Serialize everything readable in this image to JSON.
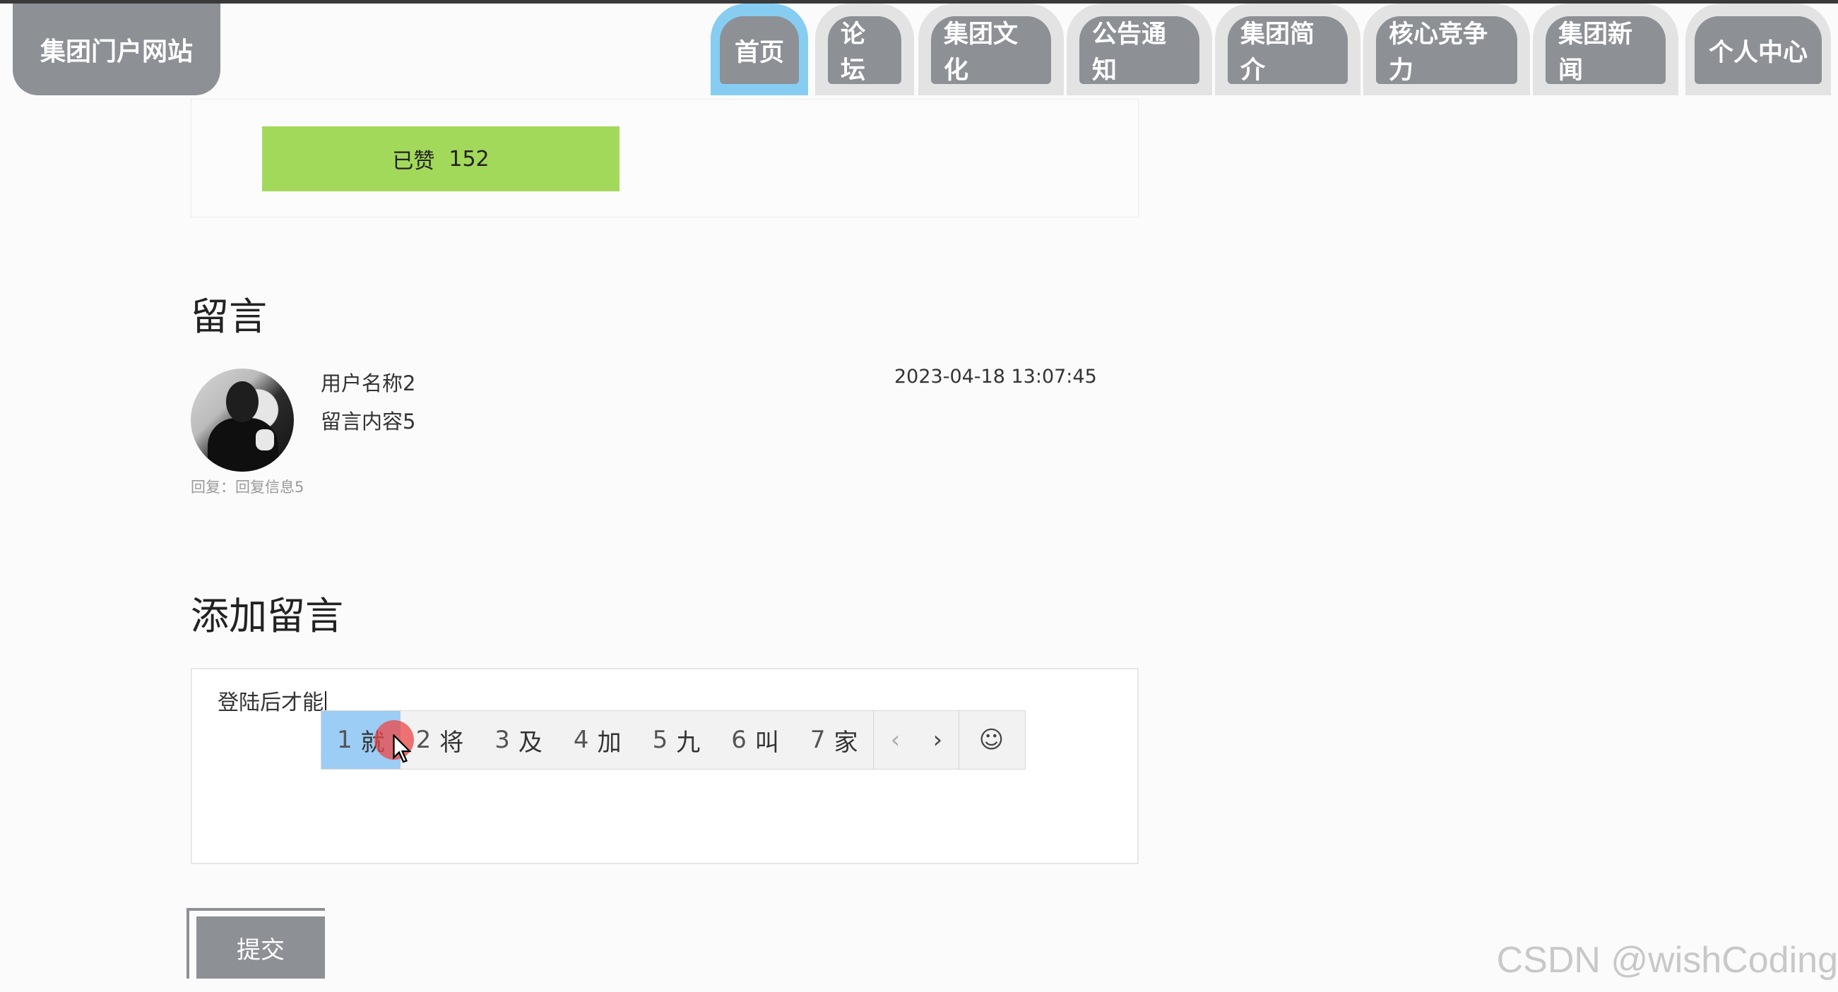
{
  "header": {
    "site_title": "集团门户网站",
    "nav": [
      {
        "label": "首页",
        "active": true
      },
      {
        "label": "论坛"
      },
      {
        "label": "集团文化"
      },
      {
        "label": "公告通知"
      },
      {
        "label": "集团简介"
      },
      {
        "label": "核心竞争力"
      },
      {
        "label": "集团新闻"
      },
      {
        "label": "个人中心"
      }
    ]
  },
  "like": {
    "label": "已赞",
    "count": "152",
    "color": "#a3d95a"
  },
  "comments_section": {
    "title": "留言",
    "items": [
      {
        "username": "用户名称2",
        "content": "留言内容5",
        "time": "2023-04-18 13:07:45",
        "reply": "回复：回复信息5"
      }
    ]
  },
  "add_comment": {
    "title": "添加留言",
    "textarea_value": "登陆后才能",
    "ime_candidates": [
      {
        "num": "1",
        "text": "就",
        "selected": true
      },
      {
        "num": "2",
        "text": "将"
      },
      {
        "num": "3",
        "text": "及"
      },
      {
        "num": "4",
        "text": "加"
      },
      {
        "num": "5",
        "text": "九"
      },
      {
        "num": "6",
        "text": "叫"
      },
      {
        "num": "7",
        "text": "家"
      }
    ],
    "ime_prev": "‹",
    "ime_next": "›",
    "ime_emoji": "☺",
    "submit_label": "提交"
  },
  "watermark": "CSDN @wishCoding",
  "colors": {
    "nav_active": "#86cdf1",
    "button_gray": "#8d9095"
  }
}
